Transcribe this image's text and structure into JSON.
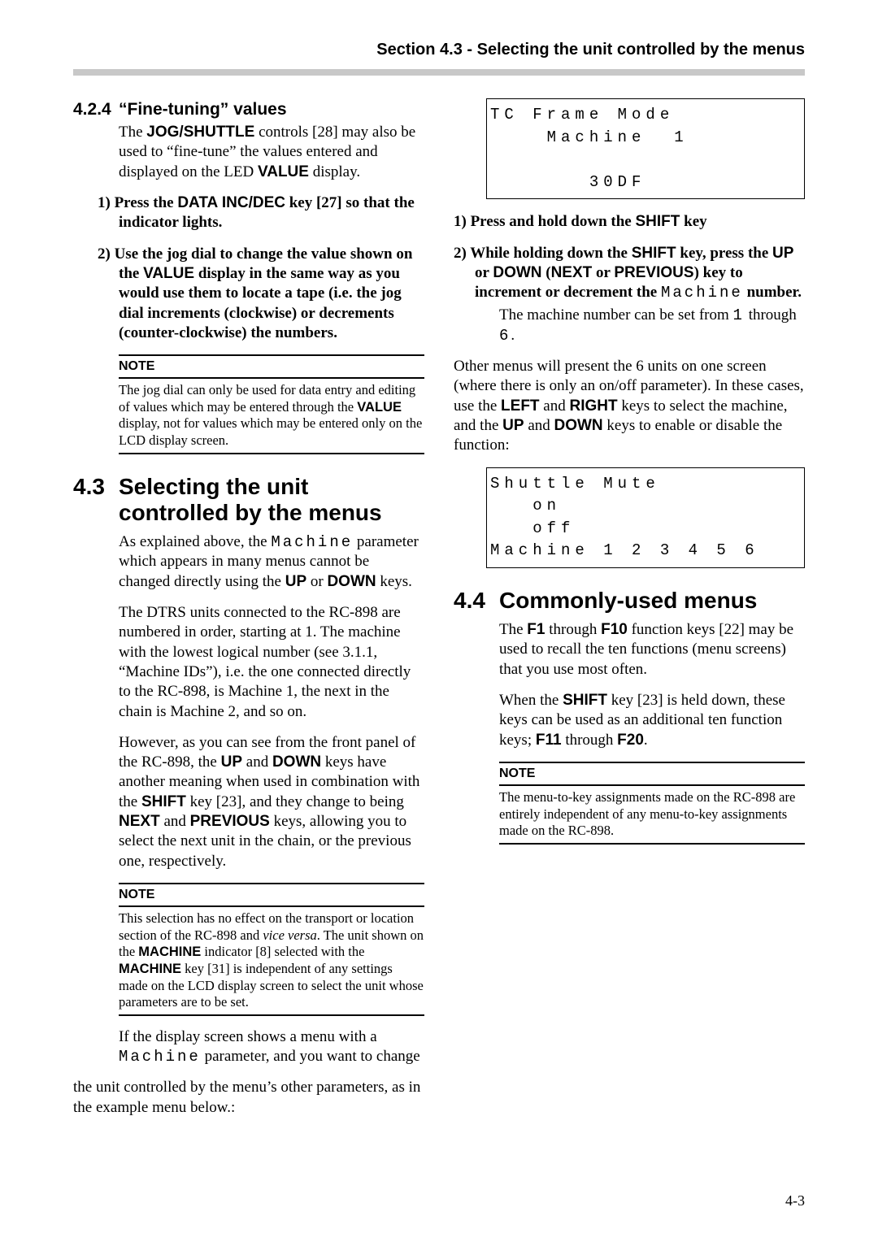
{
  "header": "Section 4.3 - Selecting the unit controlled by the menus",
  "page_number": "4-3",
  "s424": {
    "num": "4.2.4",
    "title": "“Fine-tuning” values",
    "intro_a": "The ",
    "intro_b_bold": "JOG/SHUTTLE",
    "intro_c": " controls [28] may also be used to “fine-tune” the values entered and displayed on the LED ",
    "intro_d_bold": "VALUE",
    "intro_e": " display.",
    "step1_a": "1)   Press the ",
    "step1_b_bold": "DATA INC/DEC",
    "step1_c": " key [27] so that the indicator lights.",
    "step2_a": "2)   Use the jog dial to change the value shown on the ",
    "step2_b_bold": "VALUE",
    "step2_c": " display in the same way as you would use them to locate a tape (i.e. the jog dial increments (clockwise) or decrements (counter-clockwise) the numbers.",
    "note_label": "NOTE",
    "note_text_a": "The jog dial can only be used for data entry and editing of values which may be entered through the ",
    "note_text_b_bold": "VALUE",
    "note_text_c": " display, not for values which may be entered only on the LCD display screen."
  },
  "s43": {
    "num": "4.3",
    "title": "Selecting the unit controlled by the menus",
    "p1_a": "As explained above, the ",
    "p1_mono": "Machine",
    "p1_b": " parameter which appears in many menus cannot be changed directly using the ",
    "p1_c_bold": "UP",
    "p1_d": " or ",
    "p1_e_bold": "DOWN",
    "p1_f": " keys.",
    "p2": "The DTRS units connected to the RC-898 are numbered in order, starting at 1. The machine with the lowest logical number (see 3.1.1, “Machine IDs”), i.e. the one connected directly to the RC-898, is Machine 1, the next in the chain is Machine 2, and so on.",
    "p3_a": "However, as you can see from the front panel of the RC-898, the ",
    "p3_b_bold": "UP",
    "p3_c": " and ",
    "p3_d_bold": "DOWN",
    "p3_e": " keys have another meaning when used in combination with the ",
    "p3_f_bold": "SHIFT",
    "p3_g": " key [23], and they change to being ",
    "p3_h_bold": "NEXT",
    "p3_i": " and ",
    "p3_j_bold": "PREVIOUS",
    "p3_k": " keys, allowing you to select the next unit in the chain, or the previous one, respectively.",
    "note_label": "NOTE",
    "note_a": "This selection has no effect on the transport or location section of the RC-898 and ",
    "note_b_italic": "vice versa",
    "note_c": ". The unit shown on the ",
    "note_d_bold": "MACHINE",
    "note_e": " indicator [8] selected with the ",
    "note_f_bold": "MACHINE",
    "note_g": " key [31] is independent of any settings made on the LCD display screen to select the unit whose parameters are to be set.",
    "p4_a": "If the display screen shows a menu with a ",
    "p4_mono": "Machine",
    "p4_b": " parameter, and you want to change ",
    "p5": "the unit controlled by the menu’s other parameters, as in the example menu below.:",
    "lcd1": "TC Frame Mode\n    Machine  1\n\n       30DF",
    "step1_a": "1)   Press and hold down the ",
    "step1_b_bold": "SHIFT",
    "step1_c": " key",
    "step2_a": "2)   While holding down the ",
    "step2_b_bold": "SHIFT",
    "step2_c": " key, press the ",
    "step2_d_bold": "UP",
    "step2_e": " or ",
    "step2_f_bold": "DOWN",
    "step2_g": " (",
    "step2_h_bold": "NEXT",
    "step2_i": " or ",
    "step2_j_bold": "PREVIOUS",
    "step2_k": ") key to increment or decrement the ",
    "step2_mono": "Machine",
    "step2_l": " number.",
    "step2_sub_a": "The machine number can be set from ",
    "step2_sub_m1": "1",
    "step2_sub_b": " through ",
    "step2_sub_m2": "6",
    "step2_sub_c": ".",
    "p6_a": "Other menus will present the 6 units on one screen (where there is only an on/off parameter). In these cases, use the ",
    "p6_b_bold": "LEFT",
    "p6_c": " and ",
    "p6_d_bold": "RIGHT",
    "p6_e": " keys to select the machine, and the ",
    "p6_f_bold": "UP",
    "p6_g": " and ",
    "p6_h_bold": "DOWN",
    "p6_i": " keys to enable or disable the function:",
    "lcd2": "Shuttle Mute\n   on\n   off\nMachine 1 2 3 4 5 6"
  },
  "s44": {
    "num": "4.4",
    "title": "Commonly-used menus",
    "p1_a": "The ",
    "p1_b_bold": "F1",
    "p1_c": " through ",
    "p1_d_bold": "F10",
    "p1_e": " function keys [22] may be used to recall the ten functions (menu screens) that you use most often.",
    "p2_a": "When the ",
    "p2_b_bold": "SHIFT",
    "p2_c": " key [23] is held down, these keys can be used as an additional ten function keys; ",
    "p2_d_bold": "F11",
    "p2_e": " through ",
    "p2_f_bold": "F20",
    "p2_g": ".",
    "note_label": "NOTE",
    "note_text": "The menu-to-key assignments made on the RC-898 are entirely independent of any menu-to-key assignments made on the RC-898."
  }
}
